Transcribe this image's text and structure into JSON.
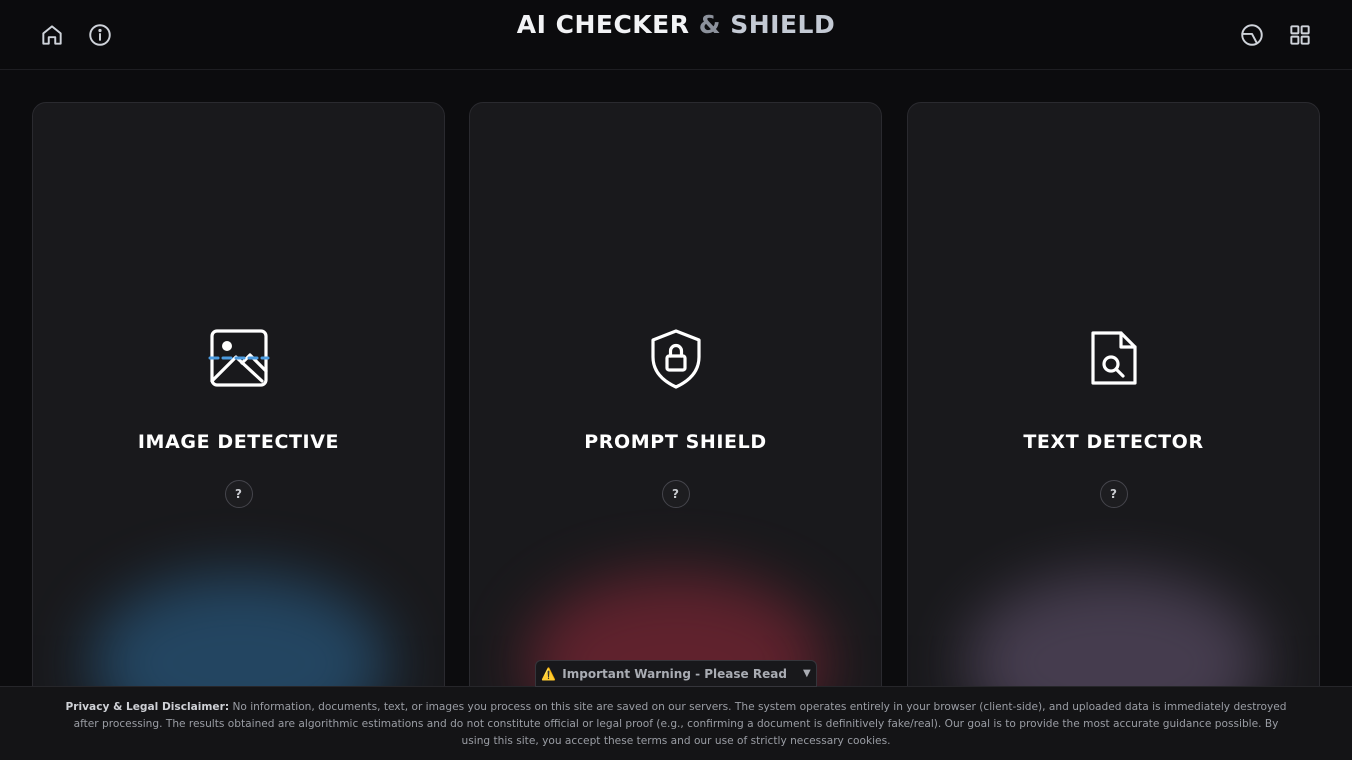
{
  "header": {
    "title_part1": "AI CHECKER",
    "title_amp": "&",
    "title_part2": "SHIELD",
    "icons": [
      "home-icon",
      "info-icon",
      "theme-icon",
      "apps-grid-icon"
    ]
  },
  "cards": [
    {
      "title": "IMAGE DETECTIVE",
      "icon": "image-scan-icon",
      "help": "?",
      "glow": "#2c6a9a"
    },
    {
      "title": "PROMPT SHIELD",
      "icon": "shield-lock-icon",
      "help": "?",
      "glow": "#9a2a3c"
    },
    {
      "title": "TEXT DETECTOR",
      "icon": "document-search-icon",
      "help": "?",
      "glow": "#6a5a78"
    }
  ],
  "warning": {
    "icon": "⚠️",
    "label": "Important Warning - Please Read",
    "caret": "▼"
  },
  "footer": {
    "heading": "Privacy & Legal Disclaimer:",
    "text": "No information, documents, text, or images you process on this site are saved on our servers. The system operates entirely in your browser (client-side), and uploaded data is immediately destroyed after processing. The results obtained are algorithmic estimations and do not constitute official or legal proof (e.g., confirming a document is definitively fake/real). Our goal is to provide the most accurate guidance possible. By using this site, you accept these terms and our use of strictly necessary cookies."
  }
}
